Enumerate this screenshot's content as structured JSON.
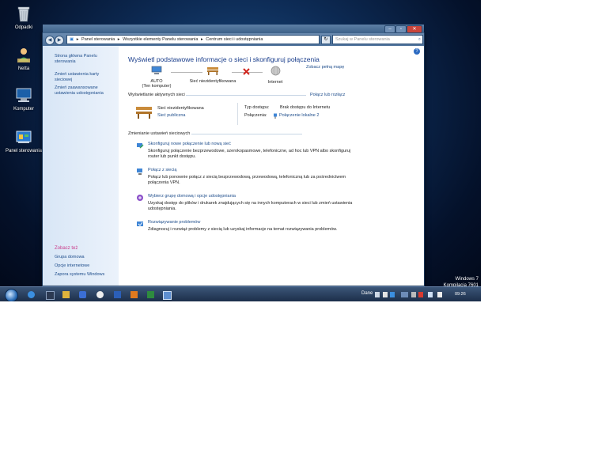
{
  "desktop": {
    "icons": [
      {
        "label": "Odpadki",
        "icon": "recycle-bin-icon"
      },
      {
        "label": "Netta",
        "icon": "user-folder-icon"
      },
      {
        "label": "Komputer",
        "icon": "computer-icon"
      },
      {
        "label": "Panel sterowania",
        "icon": "control-panel-icon"
      }
    ],
    "watermark": {
      "line1": "Windows 7",
      "line2": "Kompilacja 7601"
    }
  },
  "window": {
    "controls": {
      "minimize": "–",
      "maximize": "▫",
      "close": "✕"
    },
    "address": {
      "breadcrumbs": [
        "Panel sterowania",
        "Wszystkie elementy Panelu sterowania",
        "Centrum sieci i udostępniania"
      ],
      "separator": "▸"
    },
    "search_placeholder": "Szukaj w Panelu sterowania"
  },
  "sidebar": {
    "links": [
      "Strona główna Panelu sterowania",
      "Zmień ustawienia karty sieciowej",
      "Zmień zaawansowane ustawienia udostępniania"
    ],
    "see_also_title": "Zobacz też",
    "see_also": [
      "Grupa domowa",
      "Opcje internetowe",
      "Zapora systemu Windows"
    ]
  },
  "main": {
    "heading": "Wyświetl podstawowe informacje o sieci i skonfiguruj połączenia",
    "full_map_link": "Zobacz pełną mapę",
    "map": {
      "computer": {
        "name": "AUTO",
        "subtitle": "(Ten komputer)",
        "icon": "computer-icon"
      },
      "network": {
        "name": "Sieć niezidentyfikowana",
        "icon": "bench-network-icon"
      },
      "internet": {
        "name": "Internet",
        "icon": "globe-icon"
      }
    },
    "active_networks": {
      "title": "Wyświetlanie aktywnych sieci",
      "connect_link": "Połącz lub rozłącz",
      "network_name": "Sieć niezidentyfikowana",
      "network_type": "Sieć publiczna",
      "access_label": "Typ dostępu:",
      "access_value": "Brak dostępu do Internetu",
      "connections_label": "Połączenia:",
      "connections_value": "Połączenie lokalne 2"
    },
    "settings": {
      "title": "Zmienianie ustawień sieciowych",
      "tasks": [
        {
          "title": "Skonfiguruj nowe połączenie lub nową sieć",
          "desc": "Skonfiguruj połączenie bezprzewodowe, szerokopasmowe, telefoniczne, ad hoc lub VPN albo skonfiguruj router lub punkt dostępu.",
          "icon": "new-connection-icon"
        },
        {
          "title": "Połącz z siecią",
          "desc": "Połącz lub ponownie połącz z siecią bezprzewodową, przewodową, telefoniczną lub za pośrednictwem połączenia VPN.",
          "icon": "connect-network-icon"
        },
        {
          "title": "Wybierz grupę domową i opcje udostępniania",
          "desc": "Uzyskaj dostęp do plików i drukarek znajdujących się na innych komputerach w sieci lub zmień ustawienia udostępniania.",
          "icon": "homegroup-icon"
        },
        {
          "title": "Rozwiązywanie problemów",
          "desc": "Zdiagnozuj i rozwiąż problemy z siecią lub uzyskaj informacje na temat rozwiązywania problemów.",
          "icon": "troubleshoot-icon"
        }
      ]
    }
  },
  "taskbar": {
    "language": "Dane",
    "clock": "09:26"
  }
}
